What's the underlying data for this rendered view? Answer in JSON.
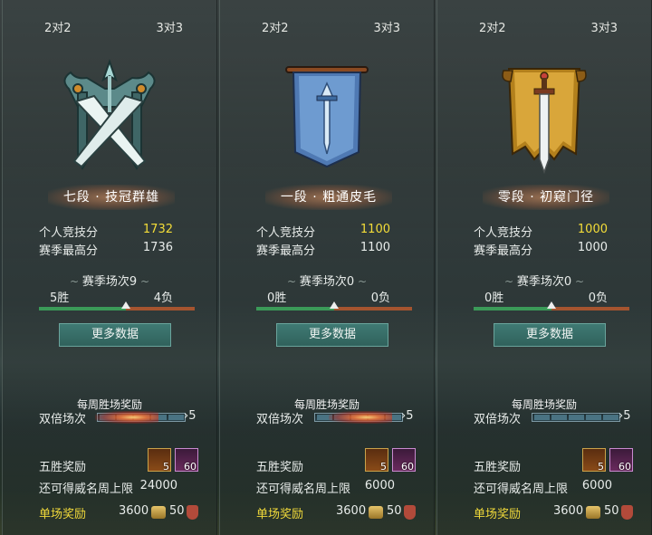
{
  "panels": [
    {
      "tab_left": "2对2",
      "tab_right": "3对3",
      "emblem": "silver-crossed-swords-emblem-icon",
      "rank": "七段 · 技冠群雄",
      "personal_label": "个人竞技分",
      "personal_value": "1732",
      "best_label": "赛季最高分",
      "best_value": "1736",
      "season_label": "赛季场次9",
      "wins": "5胜",
      "losses": "4负",
      "win_fraction": 0.56,
      "more_btn": "更多数据",
      "weekly_title": "每周胜场奖励",
      "double_label": "双倍场次",
      "double_count": "5",
      "five_label": "五胜奖励",
      "chest_count": "5",
      "gem_count": "60",
      "cap_label": "还可得威名周上限",
      "cap_value": "24000",
      "single_label": "单场奖励",
      "single_coin": "3600",
      "single_shield": "50"
    },
    {
      "tab_left": "2对2",
      "tab_right": "3对3",
      "emblem": "blue-sword-banner-icon",
      "rank": "一段 · 粗通皮毛",
      "personal_label": "个人竞技分",
      "personal_value": "1100",
      "best_label": "赛季最高分",
      "best_value": "1100",
      "season_label": "赛季场次0",
      "wins": "0胜",
      "losses": "0负",
      "win_fraction": 0.5,
      "more_btn": "更多数据",
      "weekly_title": "每周胜场奖励",
      "double_label": "双倍场次",
      "double_count": "5",
      "five_label": "五胜奖励",
      "chest_count": "5",
      "gem_count": "60",
      "cap_label": "还可得威名周上限",
      "cap_value": "6000",
      "single_label": "单场奖励",
      "single_coin": "3600",
      "single_shield": "50"
    },
    {
      "tab_left": "2对2",
      "tab_right": "3对3",
      "emblem": "gold-sword-banner-icon",
      "rank": "零段 · 初窥门径",
      "personal_label": "个人竞技分",
      "personal_value": "1000",
      "best_label": "赛季最高分",
      "best_value": "1000",
      "season_label": "赛季场次0",
      "wins": "0胜",
      "losses": "0负",
      "win_fraction": 0.5,
      "more_btn": "更多数据",
      "weekly_title": "每周胜场奖励",
      "double_label": "双倍场次",
      "double_count": "5",
      "five_label": "五胜奖励",
      "chest_count": "5",
      "gem_count": "60",
      "cap_label": "还可得威名周上限",
      "cap_value": "6000",
      "single_label": "单场奖励",
      "single_coin": "3600",
      "single_shield": "50"
    }
  ],
  "colors": {
    "score_gold": "#f4dd38",
    "reward_gold": "#f0d93a",
    "button_teal": "#30615c",
    "win_green": "#3b9a58",
    "loss_red": "#a5542f"
  }
}
